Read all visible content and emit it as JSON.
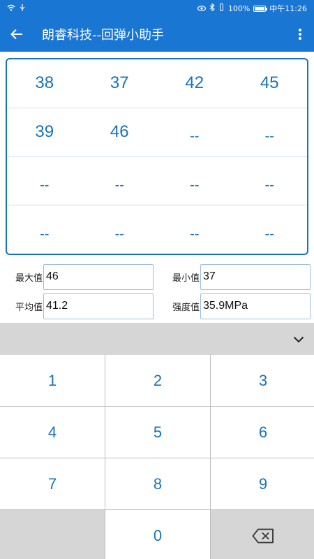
{
  "status_bar": {
    "left_icons": [
      "wifi-icon",
      "usb-icon"
    ],
    "battery": "100%",
    "time": "中午11:26",
    "right_icons": [
      "eye-icon",
      "bluetooth-icon",
      "vibrate-icon"
    ],
    "battery_level": 1.0
  },
  "app_bar": {
    "title": "朗睿科技--回弹小助手"
  },
  "grid": {
    "rows": [
      [
        "38",
        "37",
        "42",
        "45"
      ],
      [
        "39",
        "46",
        "--",
        "--"
      ],
      [
        "--",
        "--",
        "--",
        "--"
      ],
      [
        "--",
        "--",
        "--",
        "--"
      ]
    ]
  },
  "stats": {
    "max_label": "最大值",
    "max_value": "46",
    "min_label": "最小值",
    "min_value": "37",
    "avg_label": "平均值",
    "avg_value": "41.2",
    "strength_label": "强度值",
    "strength_value": "35.9MPa"
  },
  "keyboard": {
    "keys": [
      "1",
      "2",
      "3",
      "4",
      "5",
      "6",
      "7",
      "8",
      "9",
      "0"
    ]
  },
  "colors": {
    "accent": "#1976d2",
    "value_text": "#1a73b8"
  }
}
